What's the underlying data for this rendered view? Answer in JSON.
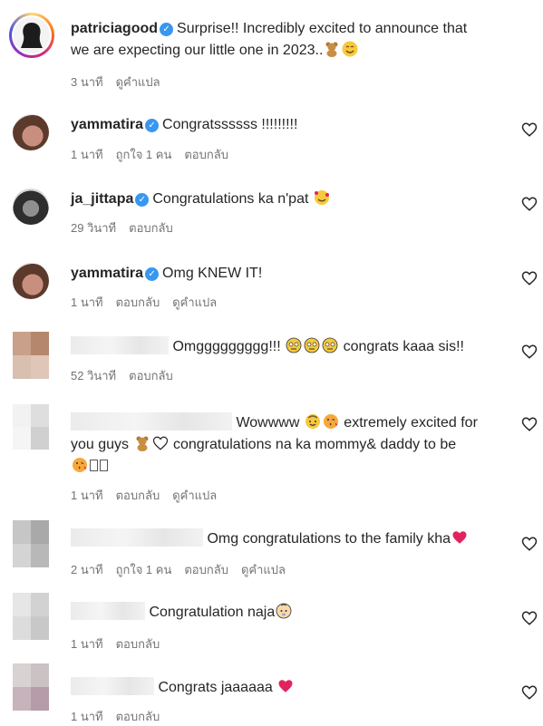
{
  "caption": {
    "username": "patriciagood",
    "text_line1": "Surprise!! Incredibly excited to announce that",
    "text_line2": "we are expecting our little one in 2023..",
    "time": "3 นาที",
    "translate": "ดูคำแปล"
  },
  "comments": [
    {
      "username": "yammatira",
      "text": "Congratssssss !!!!!!!!!",
      "time": "1 นาที",
      "likes": "ถูกใจ 1 คน",
      "reply": "ตอบกลับ"
    },
    {
      "username": "ja_jittapa",
      "text": "Congratulations ka n'pat",
      "time": "29 วินาที",
      "reply": "ตอบกลับ"
    },
    {
      "username": "yammatira",
      "text": "Omg KNEW IT!",
      "time": "1 นาที",
      "reply": "ตอบกลับ",
      "translate": "ดูคำแปล"
    },
    {
      "text": "Omggggggggg!!!",
      "text_after": "congrats kaaa sis!!",
      "time": "52 วินาที",
      "reply": "ตอบกลับ"
    },
    {
      "text": "Wowwww",
      "text_after": "extremely excited for",
      "text_line2": "you guys",
      "text_line2b": "congratulations na ka mommy& daddy to be",
      "time": "1 นาที",
      "reply": "ตอบกลับ",
      "translate": "ดูคำแปล"
    },
    {
      "text": "Omg congratulations to the family kha",
      "time": "2 นาที",
      "likes": "ถูกใจ 1 คน",
      "reply": "ตอบกลับ",
      "translate": "ดูคำแปล"
    },
    {
      "text": "Congratulation naja",
      "time": "1 นาที",
      "reply": "ตอบกลับ"
    },
    {
      "text": "Congrats jaaaaaa",
      "time": "1 นาที",
      "reply": "ตอบกลับ"
    }
  ],
  "colors": {
    "verified": "#3897f0",
    "meta": "#737373",
    "heart_red": "#e0245e",
    "story_ring": "#d62976"
  }
}
